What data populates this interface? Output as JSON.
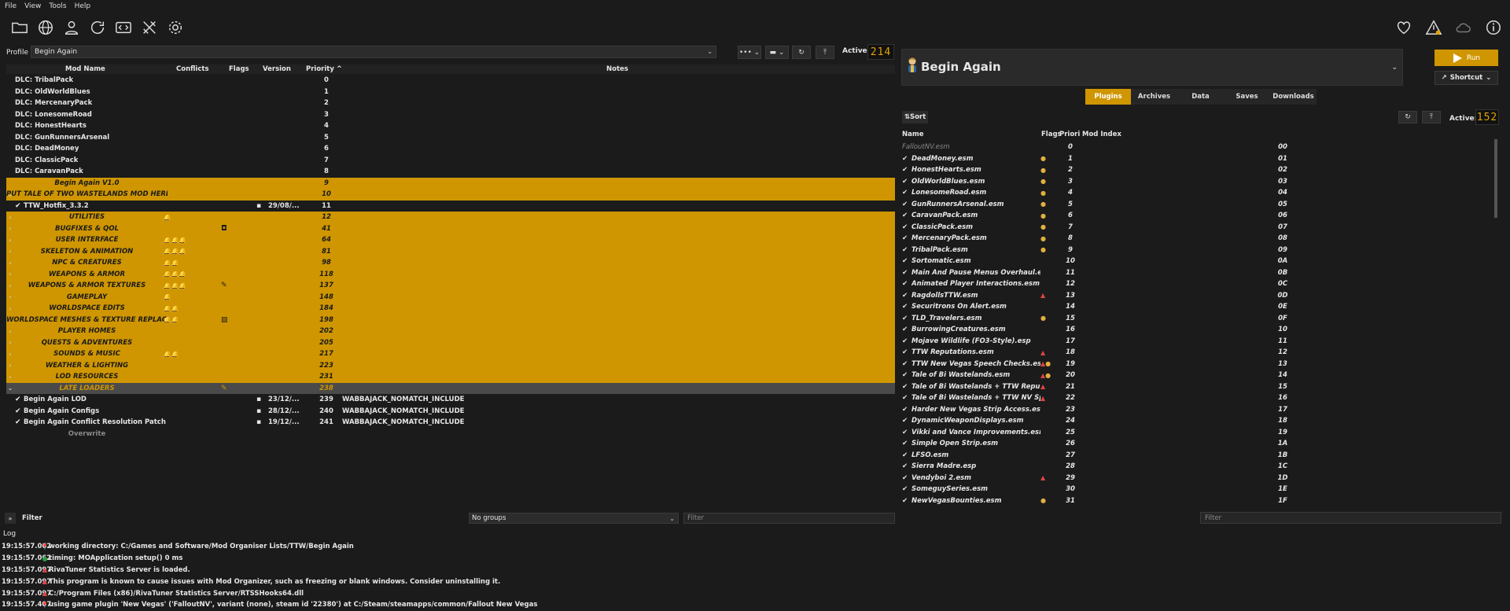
{
  "menu": [
    "File",
    "View",
    "Tools",
    "Help"
  ],
  "profile": {
    "label": "Profile",
    "value": "Begin Again",
    "active_label": "Active:",
    "active_count": "214"
  },
  "mod_columns": {
    "name": "Mod Name",
    "conflicts": "Conflicts",
    "flags": "Flags",
    "version": "Version",
    "priority": "Priority ^",
    "notes": "Notes"
  },
  "mods": [
    {
      "name": "DLC: TribalPack",
      "priority": "0",
      "type": "plain"
    },
    {
      "name": "DLC: OldWorldBlues",
      "priority": "1",
      "type": "plain"
    },
    {
      "name": "DLC: MercenaryPack",
      "priority": "2",
      "type": "plain"
    },
    {
      "name": "DLC: LonesomeRoad",
      "priority": "3",
      "type": "plain"
    },
    {
      "name": "DLC: HonestHearts",
      "priority": "4",
      "type": "plain"
    },
    {
      "name": "DLC: GunRunnersArsenal",
      "priority": "5",
      "type": "plain"
    },
    {
      "name": "DLC: DeadMoney",
      "priority": "6",
      "type": "plain"
    },
    {
      "name": "DLC: ClassicPack",
      "priority": "7",
      "type": "plain"
    },
    {
      "name": "DLC: CaravanPack",
      "priority": "8",
      "type": "plain"
    },
    {
      "name": "Begin Again V1.0",
      "priority": "9",
      "type": "sep"
    },
    {
      "name": "PUT TALE OF TWO WASTELANDS MOD HERE",
      "priority": "10",
      "type": "sep",
      "expander": "⌄"
    },
    {
      "name": "TTW_Hotfix_3.3.2",
      "priority": "11",
      "type": "mod",
      "check": "✔",
      "flag": "▪",
      "version": "29/08/..."
    },
    {
      "name": "UTILITIES",
      "priority": "12",
      "type": "sep",
      "expander": "›",
      "conflicts": "🔔"
    },
    {
      "name": "BUGFIXES & QOL",
      "priority": "41",
      "type": "sep",
      "expander": "›",
      "flag": "◘"
    },
    {
      "name": "USER INTERFACE",
      "priority": "64",
      "type": "sep",
      "expander": "›",
      "conflicts": "🔔🔔🔔"
    },
    {
      "name": "SKELETON & ANIMATION",
      "priority": "81",
      "type": "sep",
      "expander": "›",
      "conflicts": "🔔🔔🔔"
    },
    {
      "name": "NPC & CREATURES",
      "priority": "98",
      "type": "sep",
      "expander": "›",
      "conflicts": "🔔🔔"
    },
    {
      "name": "WEAPONS & ARMOR",
      "priority": "118",
      "type": "sep",
      "expander": "›",
      "conflicts": "🔔🔔🔔"
    },
    {
      "name": "WEAPONS & ARMOR TEXTURES",
      "priority": "137",
      "type": "sep",
      "expander": "›",
      "conflicts": "🔔🔔🔔",
      "flag": "✎"
    },
    {
      "name": "GAMEPLAY",
      "priority": "148",
      "type": "sep",
      "expander": "›",
      "conflicts": "🔔"
    },
    {
      "name": "WORLDSPACE EDITS",
      "priority": "184",
      "type": "sep",
      "expander": "›",
      "conflicts": "🔔🔔"
    },
    {
      "name": "WORLDSPACE MESHES & TEXTURE REPLACEME...",
      "priority": "198",
      "type": "sep",
      "expander": "›",
      "conflicts": "🔔🔔",
      "flag": "▨"
    },
    {
      "name": "PLAYER HOMES",
      "priority": "202",
      "type": "sep",
      "expander": "›"
    },
    {
      "name": "QUESTS & ADVENTURES",
      "priority": "205",
      "type": "sep",
      "expander": "›"
    },
    {
      "name": "SOUNDS & MUSIC",
      "priority": "217",
      "type": "sep",
      "expander": "›",
      "conflicts": "🔔🔔"
    },
    {
      "name": "WEATHER & LIGHTING",
      "priority": "223",
      "type": "sep",
      "expander": "›"
    },
    {
      "name": "LOD RESOURCES",
      "priority": "231",
      "type": "sep",
      "expander": "›"
    },
    {
      "name": "LATE LOADERS",
      "priority": "238",
      "type": "dark",
      "expander": "⌄",
      "flag": "✎"
    },
    {
      "name": "Begin Again LOD",
      "priority": "239",
      "type": "mod",
      "check": "✔",
      "flag": "▪",
      "version": "23/12/...",
      "notes": "WABBAJACK_NOMATCH_INCLUDE"
    },
    {
      "name": "Begin Again Configs",
      "priority": "240",
      "type": "mod",
      "check": "✔",
      "flag": "▪",
      "version": "28/12/...",
      "notes": "WABBAJACK_NOMATCH_INCLUDE"
    },
    {
      "name": "Begin Again Conflict Resolution Patch",
      "priority": "241",
      "type": "mod",
      "check": "✔",
      "flag": "▪",
      "version": "19/12/...",
      "notes": "WABBAJACK_NOMATCH_INCLUDE"
    },
    {
      "name": "Overwrite",
      "priority": "",
      "type": "overwrite"
    }
  ],
  "mod_filter": {
    "label": "Filter",
    "groups": "No groups",
    "placeholder": "Filter"
  },
  "right": {
    "title": "Begin Again",
    "run": "Run",
    "shortcut": "Shortcut",
    "tabs": [
      "Plugins",
      "Archives",
      "Data",
      "Saves",
      "Downloads"
    ],
    "sort": "Sort",
    "active_label": "Active:",
    "active_count": "152",
    "plugin_columns": {
      "name": "Name",
      "flags": "Flags",
      "priority": "Priori",
      "mod_index": "Mod Index"
    },
    "filter_placeholder": "Filter"
  },
  "plugins": [
    {
      "name": "FalloutNV.esm",
      "p": "0",
      "mi": "00",
      "f": "",
      "first": true
    },
    {
      "name": "DeadMoney.esm",
      "p": "1",
      "mi": "01",
      "f": "dot"
    },
    {
      "name": "HonestHearts.esm",
      "p": "2",
      "mi": "02",
      "f": "dot"
    },
    {
      "name": "OldWorldBlues.esm",
      "p": "3",
      "mi": "03",
      "f": "dot"
    },
    {
      "name": "LonesomeRoad.esm",
      "p": "4",
      "mi": "04",
      "f": "dot"
    },
    {
      "name": "GunRunnersArsenal.esm",
      "p": "5",
      "mi": "05",
      "f": "dot"
    },
    {
      "name": "CaravanPack.esm",
      "p": "6",
      "mi": "06",
      "f": "dot"
    },
    {
      "name": "ClassicPack.esm",
      "p": "7",
      "mi": "07",
      "f": "dot"
    },
    {
      "name": "MercenaryPack.esm",
      "p": "8",
      "mi": "08",
      "f": "dot"
    },
    {
      "name": "TribalPack.esm",
      "p": "9",
      "mi": "09",
      "f": "dot"
    },
    {
      "name": "Sortomatic.esm",
      "p": "10",
      "mi": "0A",
      "f": ""
    },
    {
      "name": "Main And Pause Menus Overhaul.esm",
      "p": "11",
      "mi": "0B",
      "f": ""
    },
    {
      "name": "Animated Player Interactions.esm",
      "p": "12",
      "mi": "0C",
      "f": ""
    },
    {
      "name": "RagdollsTTW.esm",
      "p": "13",
      "mi": "0D",
      "f": "warn"
    },
    {
      "name": "Securitrons On Alert.esm",
      "p": "14",
      "mi": "0E",
      "f": ""
    },
    {
      "name": "TLD_Travelers.esm",
      "p": "15",
      "mi": "0F",
      "f": "dot"
    },
    {
      "name": "BurrowingCreatures.esm",
      "p": "16",
      "mi": "10",
      "f": ""
    },
    {
      "name": "Mojave Wildlife (FO3-Style).esp",
      "p": "17",
      "mi": "11",
      "f": ""
    },
    {
      "name": "TTW Reputations.esm",
      "p": "18",
      "mi": "12",
      "f": "warn"
    },
    {
      "name": "TTW New Vegas Speech Checks.esm",
      "p": "19",
      "mi": "13",
      "f": "both"
    },
    {
      "name": "Tale of Bi Wastelands.esm",
      "p": "20",
      "mi": "14",
      "f": "both"
    },
    {
      "name": "Tale of Bi Wastelands + TTW Reputations ...",
      "p": "21",
      "mi": "15",
      "f": "warn"
    },
    {
      "name": "Tale of Bi Wastelands + TTW NV Speech C...",
      "p": "22",
      "mi": "16",
      "f": "warn"
    },
    {
      "name": "Harder New Vegas Strip Access.esm",
      "p": "23",
      "mi": "17",
      "f": ""
    },
    {
      "name": "DynamicWeaponDisplays.esm",
      "p": "24",
      "mi": "18",
      "f": ""
    },
    {
      "name": "Vikki and Vance Improvements.esm",
      "p": "25",
      "mi": "19",
      "f": ""
    },
    {
      "name": "Simple Open Strip.esm",
      "p": "26",
      "mi": "1A",
      "f": ""
    },
    {
      "name": "LFSO.esm",
      "p": "27",
      "mi": "1B",
      "f": ""
    },
    {
      "name": "Sierra Madre.esp",
      "p": "28",
      "mi": "1C",
      "f": ""
    },
    {
      "name": "Vendyboi 2.esm",
      "p": "29",
      "mi": "1D",
      "f": "warn"
    },
    {
      "name": "SomeguySeries.esm",
      "p": "30",
      "mi": "1E",
      "f": ""
    },
    {
      "name": "NewVegasBounties.esm",
      "p": "31",
      "mi": "1F",
      "f": "dot"
    }
  ],
  "log": {
    "title": "Log",
    "rows": [
      {
        "ts": "19:15:57.062",
        "icon": "loc",
        "text": "working directory: C:/Games and Software/Mod Organiser Lists/TTW/Begin Again"
      },
      {
        "ts": "19:15:57.062",
        "icon": "info",
        "text": "timing: MOApplication setup() 0 ms"
      },
      {
        "ts": "19:15:57.097",
        "icon": "warn",
        "text": "RivaTuner Statistics Server is loaded."
      },
      {
        "ts": "19:15:57.097",
        "icon": "warn",
        "text": "This program is known to cause issues with Mod Organizer, such as freezing or blank windows. Consider uninstalling it."
      },
      {
        "ts": "19:15:57.097",
        "icon": "warn",
        "text": "C:/Program Files (x86)/RivaTuner Statistics Server/RTSSHooks64.dll"
      },
      {
        "ts": "19:15:57.407",
        "icon": "loc",
        "text": "using game plugin 'New Vegas' ('FalloutNV', variant (none), steam id '22380') at C:/Steam/steamapps/common/Fallout New Vegas"
      }
    ]
  }
}
